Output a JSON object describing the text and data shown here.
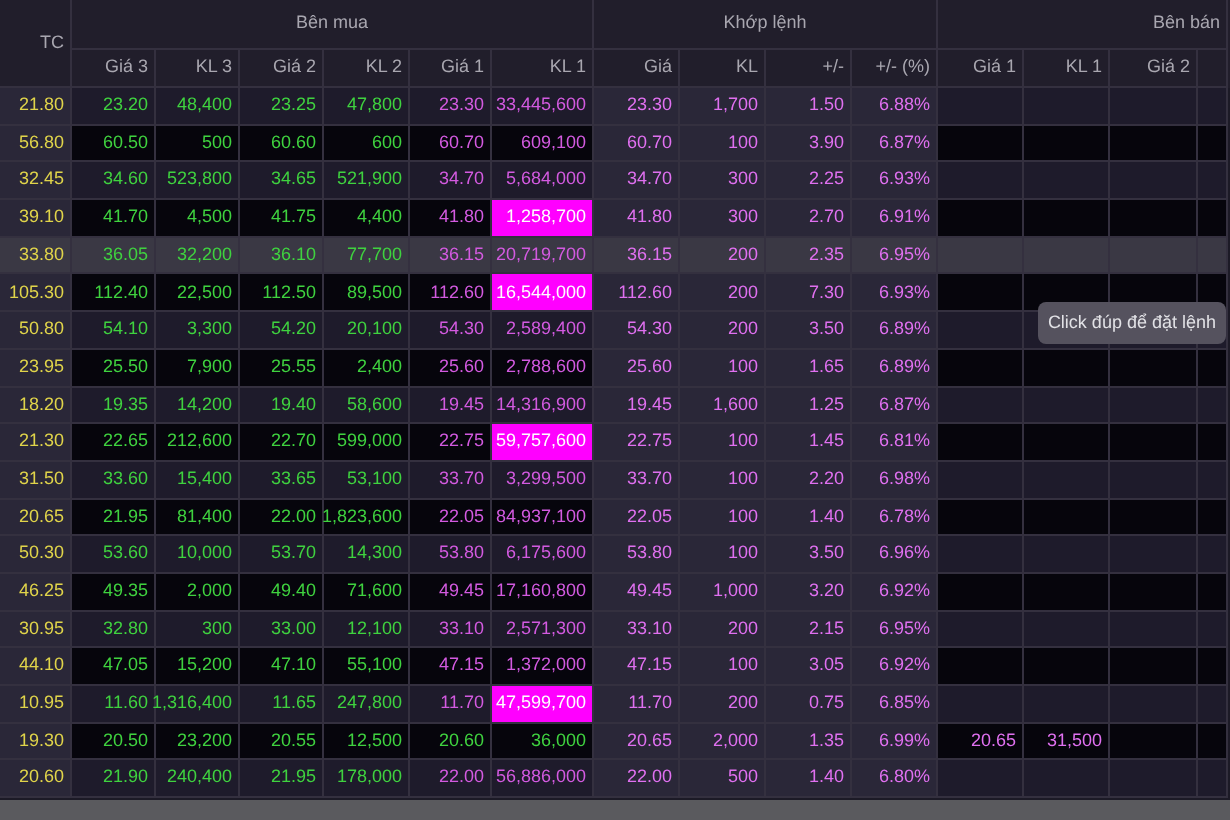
{
  "groups": [
    {
      "label": "Bên mua"
    },
    {
      "label": "Khớp lệnh"
    },
    {
      "label": "Bên bán"
    }
  ],
  "columns": {
    "ref": "TC",
    "bid": [
      "Giá 3",
      "KL 3",
      "Giá 2",
      "KL 2",
      "Giá 1",
      "KL 1"
    ],
    "match": [
      "Giá",
      "KL",
      "+/-",
      "+/- (%)"
    ],
    "ask": [
      "Giá 1",
      "KL 1",
      "Giá 2"
    ]
  },
  "rows": [
    {
      "ref": "21.80",
      "selected": false,
      "bid": [
        {
          "price": "23.20",
          "volume": "48,400"
        },
        {
          "price": "23.25",
          "volume": "47,800"
        },
        {
          "price": "23.30",
          "volume": "33,445,600",
          "ceiling": true,
          "highlighted": false
        }
      ],
      "match": {
        "price": "23.30",
        "volume": "1,700",
        "change": "1.50",
        "percent": "6.88%"
      }
    },
    {
      "ref": "56.80",
      "selected": false,
      "bid": [
        {
          "price": "60.50",
          "volume": "500"
        },
        {
          "price": "60.60",
          "volume": "600"
        },
        {
          "price": "60.70",
          "volume": "609,100",
          "ceiling": true,
          "highlighted": false
        }
      ],
      "match": {
        "price": "60.70",
        "volume": "100",
        "change": "3.90",
        "percent": "6.87%"
      }
    },
    {
      "ref": "32.45",
      "selected": false,
      "bid": [
        {
          "price": "34.60",
          "volume": "523,800"
        },
        {
          "price": "34.65",
          "volume": "521,900"
        },
        {
          "price": "34.70",
          "volume": "5,684,000",
          "ceiling": true,
          "highlighted": false
        }
      ],
      "match": {
        "price": "34.70",
        "volume": "300",
        "change": "2.25",
        "percent": "6.93%"
      }
    },
    {
      "ref": "39.10",
      "selected": false,
      "bid": [
        {
          "price": "41.70",
          "volume": "4,500"
        },
        {
          "price": "41.75",
          "volume": "4,400"
        },
        {
          "price": "41.80",
          "volume": "1,258,700",
          "ceiling": true,
          "highlighted": true
        }
      ],
      "match": {
        "price": "41.80",
        "volume": "300",
        "change": "2.70",
        "percent": "6.91%"
      }
    },
    {
      "ref": "33.80",
      "selected": true,
      "bid": [
        {
          "price": "36.05",
          "volume": "32,200"
        },
        {
          "price": "36.10",
          "volume": "77,700"
        },
        {
          "price": "36.15",
          "volume": "20,719,700",
          "ceiling": true,
          "highlighted": false
        }
      ],
      "match": {
        "price": "36.15",
        "volume": "200",
        "change": "2.35",
        "percent": "6.95%"
      }
    },
    {
      "ref": "105.30",
      "selected": false,
      "bid": [
        {
          "price": "112.40",
          "volume": "22,500"
        },
        {
          "price": "112.50",
          "volume": "89,500"
        },
        {
          "price": "112.60",
          "volume": "16,544,000",
          "ceiling": true,
          "highlighted": true
        }
      ],
      "match": {
        "price": "112.60",
        "volume": "200",
        "change": "7.30",
        "percent": "6.93%"
      }
    },
    {
      "ref": "50.80",
      "selected": false,
      "bid": [
        {
          "price": "54.10",
          "volume": "3,300"
        },
        {
          "price": "54.20",
          "volume": "20,100"
        },
        {
          "price": "54.30",
          "volume": "2,589,400",
          "ceiling": true,
          "highlighted": false
        }
      ],
      "match": {
        "price": "54.30",
        "volume": "200",
        "change": "3.50",
        "percent": "6.89%"
      }
    },
    {
      "ref": "23.95",
      "selected": false,
      "bid": [
        {
          "price": "25.50",
          "volume": "7,900"
        },
        {
          "price": "25.55",
          "volume": "2,400"
        },
        {
          "price": "25.60",
          "volume": "2,788,600",
          "ceiling": true,
          "highlighted": false
        }
      ],
      "match": {
        "price": "25.60",
        "volume": "100",
        "change": "1.65",
        "percent": "6.89%"
      }
    },
    {
      "ref": "18.20",
      "selected": false,
      "bid": [
        {
          "price": "19.35",
          "volume": "14,200"
        },
        {
          "price": "19.40",
          "volume": "58,600"
        },
        {
          "price": "19.45",
          "volume": "14,316,900",
          "ceiling": true,
          "highlighted": false
        }
      ],
      "match": {
        "price": "19.45",
        "volume": "1,600",
        "change": "1.25",
        "percent": "6.87%"
      }
    },
    {
      "ref": "21.30",
      "selected": false,
      "bid": [
        {
          "price": "22.65",
          "volume": "212,600"
        },
        {
          "price": "22.70",
          "volume": "599,000"
        },
        {
          "price": "22.75",
          "volume": "59,757,600",
          "ceiling": true,
          "highlighted": true
        }
      ],
      "match": {
        "price": "22.75",
        "volume": "100",
        "change": "1.45",
        "percent": "6.81%"
      }
    },
    {
      "ref": "31.50",
      "selected": false,
      "bid": [
        {
          "price": "33.60",
          "volume": "15,400"
        },
        {
          "price": "33.65",
          "volume": "53,100"
        },
        {
          "price": "33.70",
          "volume": "3,299,500",
          "ceiling": true,
          "highlighted": false
        }
      ],
      "match": {
        "price": "33.70",
        "volume": "100",
        "change": "2.20",
        "percent": "6.98%"
      }
    },
    {
      "ref": "20.65",
      "selected": false,
      "bid": [
        {
          "price": "21.95",
          "volume": "81,400"
        },
        {
          "price": "22.00",
          "volume": "1,823,600"
        },
        {
          "price": "22.05",
          "volume": "84,937,100",
          "ceiling": true,
          "highlighted": false
        }
      ],
      "match": {
        "price": "22.05",
        "volume": "100",
        "change": "1.40",
        "percent": "6.78%"
      }
    },
    {
      "ref": "50.30",
      "selected": false,
      "bid": [
        {
          "price": "53.60",
          "volume": "10,000"
        },
        {
          "price": "53.70",
          "volume": "14,300"
        },
        {
          "price": "53.80",
          "volume": "6,175,600",
          "ceiling": true,
          "highlighted": false
        }
      ],
      "match": {
        "price": "53.80",
        "volume": "100",
        "change": "3.50",
        "percent": "6.96%"
      }
    },
    {
      "ref": "46.25",
      "selected": false,
      "bid": [
        {
          "price": "49.35",
          "volume": "2,000"
        },
        {
          "price": "49.40",
          "volume": "71,600"
        },
        {
          "price": "49.45",
          "volume": "17,160,800",
          "ceiling": true,
          "highlighted": false
        }
      ],
      "match": {
        "price": "49.45",
        "volume": "1,000",
        "change": "3.20",
        "percent": "6.92%"
      }
    },
    {
      "ref": "30.95",
      "selected": false,
      "bid": [
        {
          "price": "32.80",
          "volume": "300"
        },
        {
          "price": "33.00",
          "volume": "12,100"
        },
        {
          "price": "33.10",
          "volume": "2,571,300",
          "ceiling": true,
          "highlighted": false
        }
      ],
      "match": {
        "price": "33.10",
        "volume": "200",
        "change": "2.15",
        "percent": "6.95%"
      }
    },
    {
      "ref": "44.10",
      "selected": false,
      "bid": [
        {
          "price": "47.05",
          "volume": "15,200"
        },
        {
          "price": "47.10",
          "volume": "55,100"
        },
        {
          "price": "47.15",
          "volume": "1,372,000",
          "ceiling": true,
          "highlighted": false
        }
      ],
      "match": {
        "price": "47.15",
        "volume": "100",
        "change": "3.05",
        "percent": "6.92%"
      }
    },
    {
      "ref": "10.95",
      "selected": false,
      "bid": [
        {
          "price": "11.60",
          "volume": "1,316,400"
        },
        {
          "price": "11.65",
          "volume": "247,800"
        },
        {
          "price": "11.70",
          "volume": "47,599,700",
          "ceiling": true,
          "highlighted": true
        }
      ],
      "match": {
        "price": "11.70",
        "volume": "200",
        "change": "0.75",
        "percent": "6.85%"
      }
    },
    {
      "ref": "19.30",
      "selected": false,
      "bid": [
        {
          "price": "20.50",
          "volume": "23,200"
        },
        {
          "price": "20.55",
          "volume": "12,500"
        },
        {
          "price": "20.60",
          "volume": "36,000",
          "ceiling": false,
          "highlighted": false
        }
      ],
      "match": {
        "price": "20.65",
        "volume": "2,000",
        "change": "1.35",
        "percent": "6.99%"
      },
      "ask": [
        {
          "price": "20.65",
          "volume": "31,500"
        }
      ]
    },
    {
      "ref": "20.60",
      "selected": false,
      "bid": [
        {
          "price": "21.90",
          "volume": "240,400"
        },
        {
          "price": "21.95",
          "volume": "178,000"
        },
        {
          "price": "22.00",
          "volume": "56,886,000",
          "ceiling": true,
          "highlighted": false
        }
      ],
      "match": {
        "price": "22.00",
        "volume": "500",
        "change": "1.40",
        "percent": "6.80%"
      }
    }
  ],
  "tooltip": {
    "text": "Click đúp để đặt lệnh"
  }
}
